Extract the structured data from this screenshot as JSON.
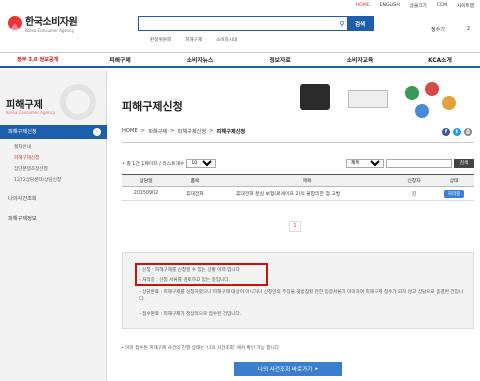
{
  "util": {
    "home": "HOME",
    "english": "ENGLISH",
    "fontsize": "글꼴크기",
    "ccm": "CCM",
    "sitemap": "사이트맵"
  },
  "logo": {
    "ko": "한국소비자원",
    "en": "Korea Consumer Agency"
  },
  "search": {
    "placeholder": "",
    "button": "검색",
    "quick": [
      "판정위원회",
      "피해구제",
      "소비자시대"
    ]
  },
  "header_right": {
    "member": "정수기",
    "count": "2"
  },
  "nav": {
    "first": "정부 3.0 정보공개",
    "items": [
      "피해구제",
      "소비자뉴스",
      "정보자료",
      "소비자교육",
      "KCA소개"
    ]
  },
  "sidebar": {
    "title": "피해구제",
    "subtitle": "Korea Consumer Agency",
    "active": "피해구제신청",
    "subitems": [
      "절차안내",
      "피해구제신청",
      "집단분쟁조정신청",
      "1372상담센터/상담신청"
    ],
    "items": [
      "나의사건조회",
      "피해구제정보"
    ]
  },
  "content": {
    "title": "피해구제신청",
    "breadcrumb": [
      "HOME",
      "피해구제",
      "피해구제신청",
      "피해구제신청"
    ],
    "list_info": "• 총 1건 1페이지 / 리스트개수",
    "list_count": "10",
    "filter": "제목",
    "filter_button": "검색",
    "table": {
      "headers": [
        "상담일",
        "품목",
        "제목",
        "신청자",
        "상태"
      ],
      "rows": [
        {
          "date": "20150902",
          "item": "휴대전화",
          "title": "휴대전화 분실 보험(로세이프 2)의 불합리한 점 고발",
          "applicant": "김",
          "status": "처리중"
        }
      ]
    },
    "page": "1",
    "notice": {
      "line1": "- 신청 : 피해구제를 신청할 수 있는 상황 이력 입니다",
      "line2": "- 처리중 : 신청 서류를 검토하고 있는 중입니다.",
      "line3": "- 상담완료 : 피해구제를 신청하였으나 피해구제 대상이 아니거나 신청인의 주장을 뒷받침할 만한 입증서류가 미미하여 피해구제 접수가 되지 않고 상담으로 종결된 건입니다.",
      "line4": "- 접수완료 : 피해구제가 정상적으로 접수된 건입니다."
    },
    "footnote": "• 이미 접수된 피해구제 사건의 진행 상태는 '나의 사건조회' 에서 확인 가능 합니다",
    "bigbutton": "나의 사건조회 바로가기"
  }
}
